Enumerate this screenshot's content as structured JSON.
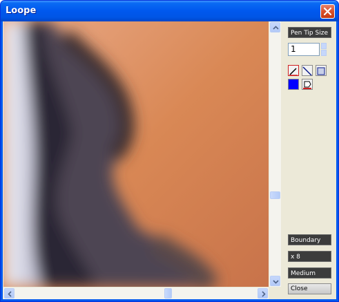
{
  "window": {
    "title": "Loope"
  },
  "panel": {
    "pen_tip_label": "Pen Tip Size",
    "pen_tip_value": "1",
    "tools": [
      "pen-tool-icon",
      "line-tool-icon",
      "rectangle-tool-icon",
      "fill-color-icon",
      "bucket-color-icon"
    ],
    "fill_color": "#0000ff",
    "boundary_label": "Boundary",
    "zoom_label": "x 8",
    "size_label": "Medium",
    "close_label": "Close"
  },
  "colors": {
    "titlebar": "#0058ee",
    "client": "#ece9d8",
    "skin": "#d58a5f",
    "dark_edge": "#2e2a38",
    "light_bg": "#dcdcea"
  },
  "scroll": {
    "vertical_position": 0.62,
    "horizontal_position": 0.62
  }
}
